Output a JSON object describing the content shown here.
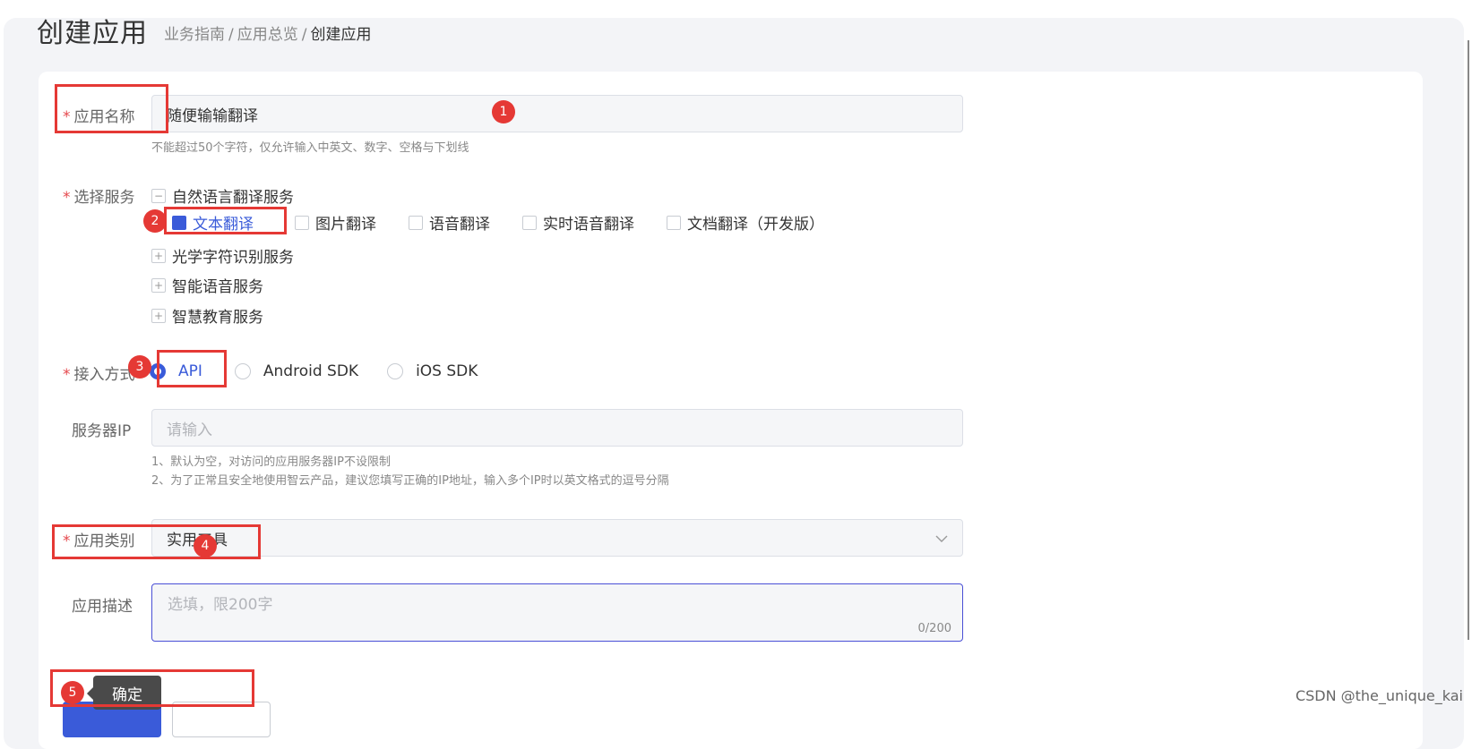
{
  "header": {
    "title": "创建应用",
    "breadcrumb": [
      "业务指南",
      "应用总览",
      "创建应用"
    ],
    "breadcrumb_sep": "/"
  },
  "form": {
    "required_mark": "*",
    "app_name": {
      "label": "应用名称",
      "value": "随便输输翻译",
      "hint": "不能超过50个字符，仅允许输入中英文、数字、空格与下划线"
    },
    "services": {
      "label": "选择服务",
      "groups": [
        {
          "label": "自然语言翻译服务",
          "toggle": "−"
        },
        {
          "label": "光学字符识别服务",
          "toggle": "+"
        },
        {
          "label": "智能语音服务",
          "toggle": "+"
        },
        {
          "label": "智慧教育服务",
          "toggle": "+"
        }
      ],
      "sub_items": [
        {
          "label": "文本翻译",
          "checked": true
        },
        {
          "label": "图片翻译",
          "checked": false
        },
        {
          "label": "语音翻译",
          "checked": false
        },
        {
          "label": "实时语音翻译",
          "checked": false
        },
        {
          "label": "文档翻译（开发版）",
          "checked": false
        }
      ]
    },
    "access": {
      "label": "接入方式",
      "options": [
        {
          "label": "API",
          "selected": true
        },
        {
          "label": "Android SDK",
          "selected": false
        },
        {
          "label": "iOS SDK",
          "selected": false
        }
      ]
    },
    "server_ip": {
      "label": "服务器IP",
      "placeholder": "请输入",
      "hints": [
        "1、默认为空，对访问的应用服务器IP不设限制",
        "2、为了正常且安全地使用智云产品，建议您填写正确的IP地址，输入多个IP时以英文格式的逗号分隔"
      ]
    },
    "category": {
      "label": "应用类别",
      "value": "实用工具"
    },
    "description": {
      "label": "应用描述",
      "placeholder": "选填，限200字",
      "count": "0/200"
    }
  },
  "actions": {
    "tooltip": "确定"
  },
  "annotations": [
    "1",
    "2",
    "3",
    "4",
    "5"
  ],
  "watermark": "CSDN @the_unique_kai",
  "colors": {
    "accent": "#3a5bd9",
    "highlight": "#e53935",
    "required": "#e5484d"
  }
}
